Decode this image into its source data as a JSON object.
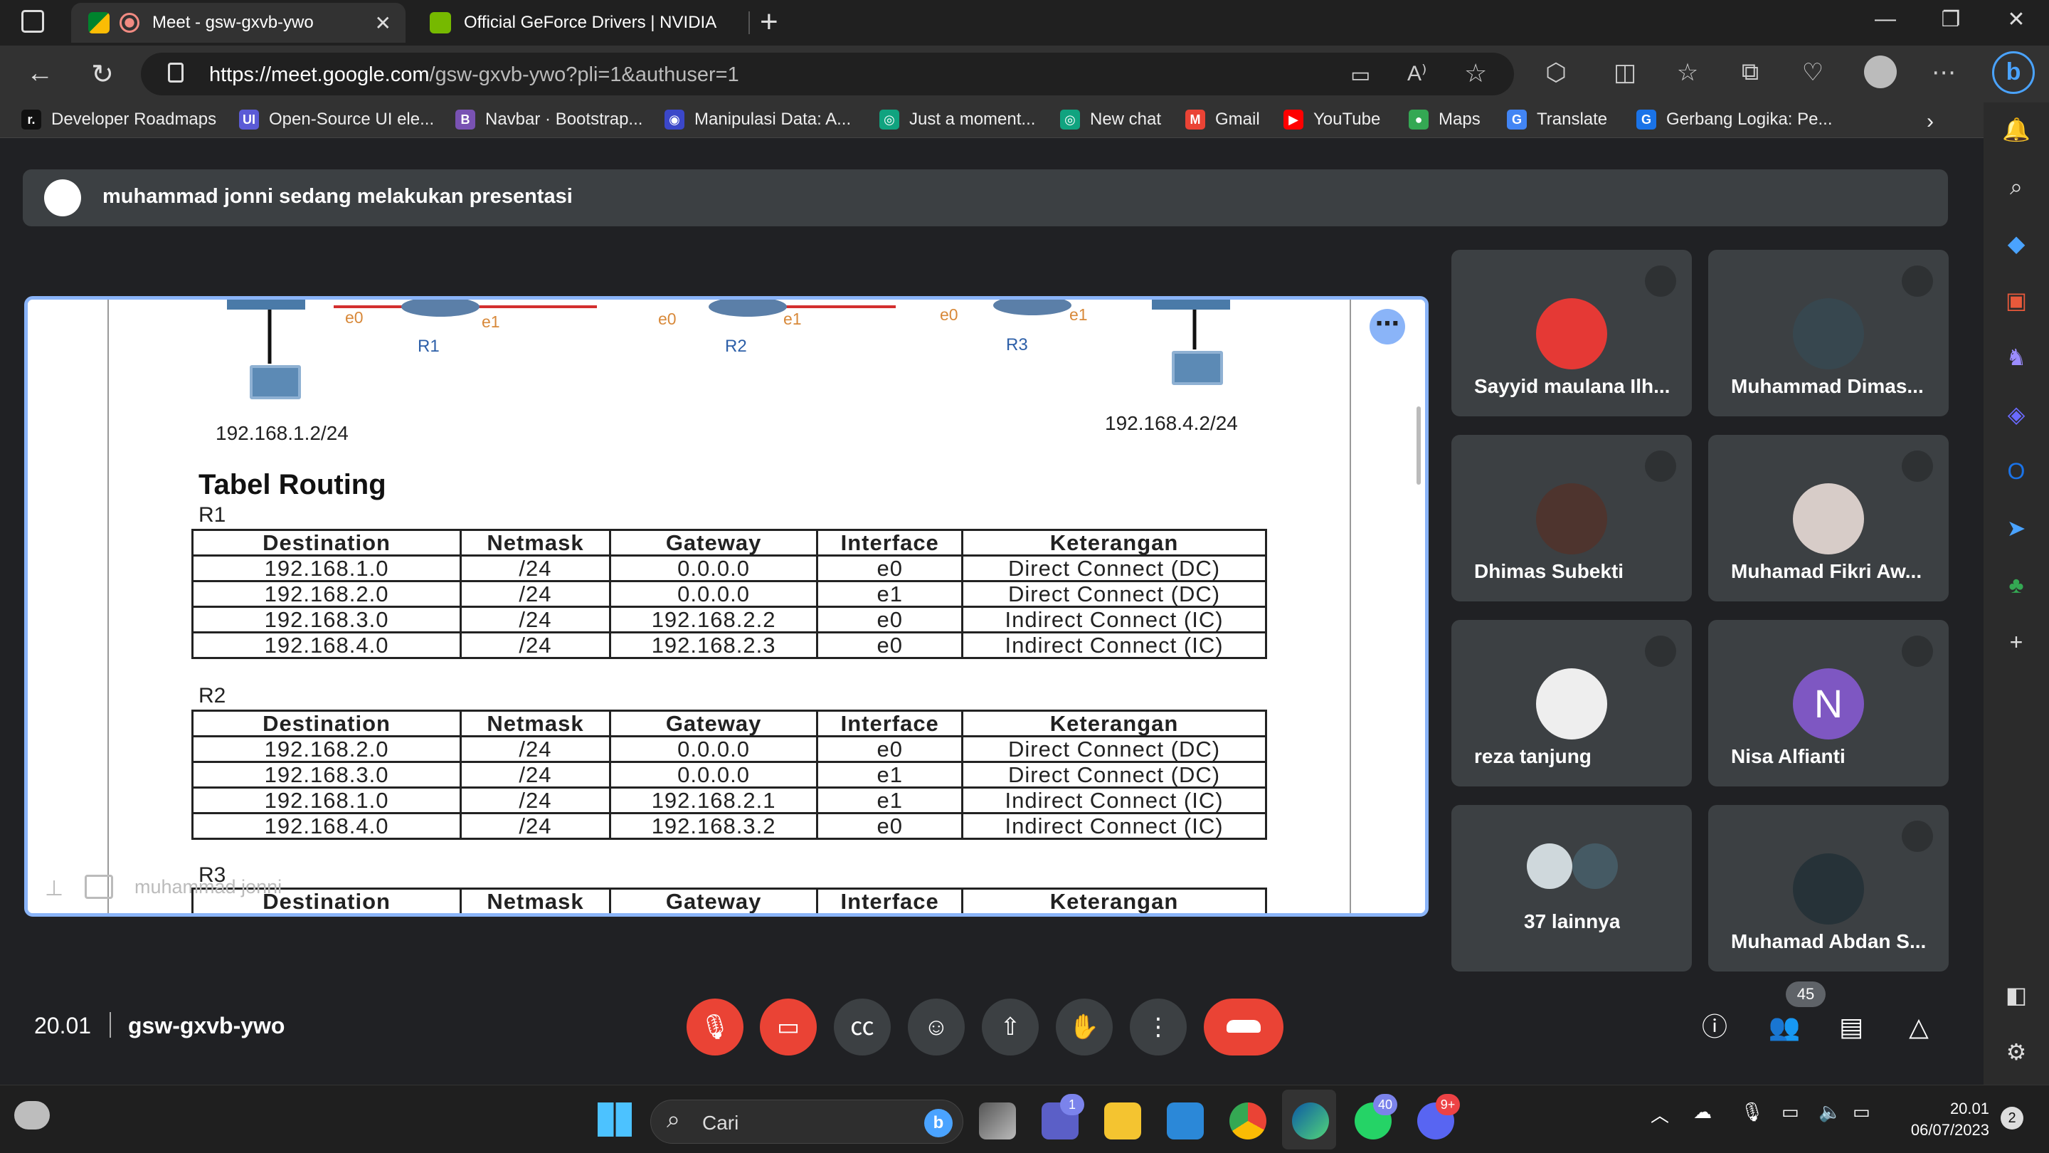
{
  "browser": {
    "tabs": [
      {
        "label": "Meet - gsw-gxvb-ywo",
        "active": true
      },
      {
        "label": "Official GeForce Drivers | NVIDIA",
        "active": false
      }
    ],
    "url_host": "https://meet.google.com",
    "url_path": "/gsw-gxvb-ywo?pli=1&authuser=1",
    "bookmarks": [
      {
        "label": "Developer Roadmaps",
        "icon": "r.",
        "color": "#111111"
      },
      {
        "label": "Open-Source UI ele...",
        "icon": "UI",
        "color": "#5b5bd6"
      },
      {
        "label": "Navbar · Bootstrap...",
        "icon": "B",
        "color": "#7952b3"
      },
      {
        "label": "Manipulasi Data: A...",
        "icon": "◉",
        "color": "#3b47c9"
      },
      {
        "label": "Just a moment...",
        "icon": "◎",
        "color": "#10a37f"
      },
      {
        "label": "New chat",
        "icon": "◎",
        "color": "#10a37f"
      },
      {
        "label": "Gmail",
        "icon": "M",
        "color": "#ea4335"
      },
      {
        "label": "YouTube",
        "icon": "▶",
        "color": "#ff0000"
      },
      {
        "label": "Maps",
        "icon": "●",
        "color": "#34a853"
      },
      {
        "label": "Translate",
        "icon": "G",
        "color": "#4285f4"
      },
      {
        "label": "Gerbang Logika: Pe...",
        "icon": "G",
        "color": "#1a73e8"
      }
    ]
  },
  "meet": {
    "presenting_text": "muhammad jonni sedang melakukan presentasi",
    "presenter_footer": "muhammad jonni",
    "clock": "20.01",
    "meeting_code": "gsw-gxvb-ywo",
    "participants_count": "45",
    "tiles": [
      {
        "name": "Sayyid maulana Ilh...",
        "muted": true
      },
      {
        "name": "Muhammad Dimas...",
        "muted": true
      },
      {
        "name": "Dhimas Subekti",
        "muted": true
      },
      {
        "name": "Muhamad Fikri Aw...",
        "muted": true
      },
      {
        "name": "reza tanjung",
        "muted": true
      },
      {
        "name": "Nisa Alfianti",
        "muted": true,
        "initial": "N"
      },
      {
        "name": "37 lainnya"
      },
      {
        "name": "Muhamad Abdan S...",
        "muted": true
      }
    ]
  },
  "slide": {
    "routers": [
      "R1",
      "R2",
      "R3"
    ],
    "interfaces": [
      "e0",
      "e1",
      "e0",
      "e1",
      "e0",
      "e1"
    ],
    "host_left": "192.168.1.2/24",
    "host_right": "192.168.4.2/24",
    "section_title": "Tabel Routing",
    "headers": [
      "Destination",
      "Netmask",
      "Gateway",
      "Interface",
      "Keterangan"
    ],
    "tables": [
      {
        "label": "R1",
        "rows": [
          [
            "192.168.1.0",
            "/24",
            "0.0.0.0",
            "e0",
            "Direct Connect (DC)"
          ],
          [
            "192.168.2.0",
            "/24",
            "0.0.0.0",
            "e1",
            "Direct Connect (DC)"
          ],
          [
            "192.168.3.0",
            "/24",
            "192.168.2.2",
            "e0",
            "Indirect Connect (IC)"
          ],
          [
            "192.168.4.0",
            "/24",
            "192.168.2.3",
            "e0",
            "Indirect Connect (IC)"
          ]
        ]
      },
      {
        "label": "R2",
        "rows": [
          [
            "192.168.2.0",
            "/24",
            "0.0.0.0",
            "e0",
            "Direct Connect (DC)"
          ],
          [
            "192.168.3.0",
            "/24",
            "0.0.0.0",
            "e1",
            "Direct Connect (DC)"
          ],
          [
            "192.168.1.0",
            "/24",
            "192.168.2.1",
            "e1",
            "Indirect Connect (IC)"
          ],
          [
            "192.168.4.0",
            "/24",
            "192.168.3.2",
            "e0",
            "Indirect Connect (IC)"
          ]
        ]
      },
      {
        "label": "R3",
        "rows": []
      }
    ]
  },
  "taskbar": {
    "search_placeholder": "Cari",
    "time": "20.01",
    "date": "06/07/2023",
    "badges": {
      "teams": "1",
      "whatsapp": "40",
      "discord": "9+",
      "notifications": "2"
    }
  }
}
